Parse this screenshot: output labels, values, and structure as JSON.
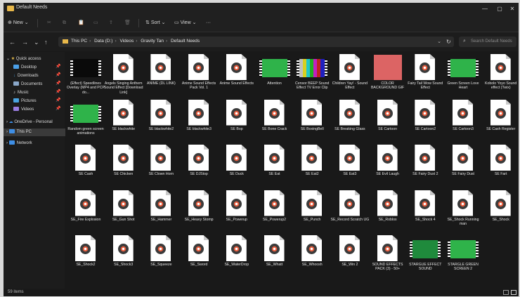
{
  "window": {
    "title": "Default Needs"
  },
  "controls": {
    "minimize": "—",
    "maximize": "▢",
    "close": "✕"
  },
  "toolbar": {
    "new": "New",
    "new_icon": "plus-icon",
    "cut": "✂",
    "copy": "⧉",
    "paste": "📋",
    "rename": "▭",
    "share": "⇪",
    "delete": "🗑",
    "sort": "Sort",
    "view": "View",
    "more": "···"
  },
  "nav_buttons": {
    "back": "←",
    "forward": "→",
    "down": "⌄",
    "up": "↑",
    "refresh": "↻",
    "chevron": "⌄"
  },
  "breadcrumbs": [
    "This PC",
    "Data (D:)",
    "Videos",
    "Gravity Tan",
    "Default Needs"
  ],
  "search": {
    "placeholder": "Search Default Needs"
  },
  "sidebar": {
    "quick_access": "Quick access",
    "items": [
      {
        "label": "Desktop",
        "color": "#4a9fe8"
      },
      {
        "label": "Downloads",
        "color": "#4aa3e0"
      },
      {
        "label": "Documents",
        "color": "#8aa7c8"
      },
      {
        "label": "Music",
        "color": "#e0e0e0"
      },
      {
        "label": "Pictures",
        "color": "#4aa3e0"
      },
      {
        "label": "Videos",
        "color": "#9a7de0"
      }
    ],
    "onedrive": "OneDrive - Personal",
    "this_pc": "This PC",
    "network": "Network"
  },
  "files": [
    {
      "name": "(Effect) Speedlines Overlay (MP4 and PCP do...",
      "thumb": "video",
      "frame": "#0a0a0a"
    },
    {
      "name": "Angels Singing Anthem Sound Effect [Download Link]",
      "thumb": "audio"
    },
    {
      "name": "ANIME (DL LINK)",
      "thumb": "audio"
    },
    {
      "name": "Anime Sound Effects Pack Vol. 1",
      "thumb": "audio"
    },
    {
      "name": "Anime Sound Effects",
      "thumb": "audio"
    },
    {
      "name": "Attention",
      "thumb": "video",
      "frame": "#2fb34a"
    },
    {
      "name": "Censor BEEP Sound Effect TV Error Clip",
      "thumb": "video",
      "frame": "bars"
    },
    {
      "name": "Children Yay! - Sound Effect",
      "thumb": "audio"
    },
    {
      "name": "COLOR BACKGROUND GIF",
      "thumb": "image",
      "frame": "#dc6464"
    },
    {
      "name": "Fairy Tail Wow Sound Effect",
      "thumb": "audio"
    },
    {
      "name": "Green Screen Love Heart",
      "thumb": "video",
      "frame": "#2fb34a"
    },
    {
      "name": "Kobolo Yoyo Sound effect (Twix)",
      "thumb": "audio"
    },
    {
      "name": "Random green screen animations",
      "thumb": "video",
      "frame": "#2fb34a"
    },
    {
      "name": "SE blackwhite",
      "thumb": "audio"
    },
    {
      "name": "SE blackwhite2",
      "thumb": "audio"
    },
    {
      "name": "SE blackwhite3",
      "thumb": "audio"
    },
    {
      "name": "SE Bop",
      "thumb": "audio"
    },
    {
      "name": "SE Bone Crack",
      "thumb": "audio"
    },
    {
      "name": "SE BoxingBell",
      "thumb": "audio"
    },
    {
      "name": "SE Breaking Glass",
      "thumb": "audio"
    },
    {
      "name": "SE Cartoon",
      "thumb": "audio"
    },
    {
      "name": "SE Cartoon2",
      "thumb": "audio"
    },
    {
      "name": "SE Cartoon3",
      "thumb": "audio"
    },
    {
      "name": "SE Cash Register",
      "thumb": "audio"
    },
    {
      "name": "SE Cash",
      "thumb": "audio"
    },
    {
      "name": "SE Chicken",
      "thumb": "audio"
    },
    {
      "name": "SE Clown Horn",
      "thumb": "audio"
    },
    {
      "name": "SE DJStop",
      "thumb": "audio"
    },
    {
      "name": "SE Duck",
      "thumb": "audio"
    },
    {
      "name": "SE Eat",
      "thumb": "audio"
    },
    {
      "name": "SE Eat2",
      "thumb": "audio"
    },
    {
      "name": "SE Eat3",
      "thumb": "audio"
    },
    {
      "name": "SE Evil Laugh",
      "thumb": "audio"
    },
    {
      "name": "SE Fairy Dust 2",
      "thumb": "audio"
    },
    {
      "name": "SE Fairy Dust",
      "thumb": "audio"
    },
    {
      "name": "SE Fart",
      "thumb": "audio"
    },
    {
      "name": "SE_Fire Explosion",
      "thumb": "audio"
    },
    {
      "name": "SE_Gun Shot",
      "thumb": "audio"
    },
    {
      "name": "SE_Hammer",
      "thumb": "audio"
    },
    {
      "name": "SE_Heavy Stomp",
      "thumb": "audio"
    },
    {
      "name": "SE_Powerup",
      "thumb": "audio"
    },
    {
      "name": "SE_Powerup2",
      "thumb": "audio"
    },
    {
      "name": "SE_Punch",
      "thumb": "audio"
    },
    {
      "name": "SE_Record Scratch UG",
      "thumb": "audio"
    },
    {
      "name": "SE_Roblox",
      "thumb": "audio"
    },
    {
      "name": "SE_Shock 4",
      "thumb": "audio"
    },
    {
      "name": "SE_Shock Running man",
      "thumb": "audio"
    },
    {
      "name": "SE_Shock",
      "thumb": "audio"
    },
    {
      "name": "SE_Shock2",
      "thumb": "audio"
    },
    {
      "name": "SE_Shock3",
      "thumb": "audio"
    },
    {
      "name": "SE_Squeeze",
      "thumb": "audio"
    },
    {
      "name": "SE_Sword",
      "thumb": "audio"
    },
    {
      "name": "SE_WaterDrop",
      "thumb": "audio"
    },
    {
      "name": "SE_Whatt",
      "thumb": "audio"
    },
    {
      "name": "SE_Whoosh",
      "thumb": "audio"
    },
    {
      "name": "SE_Win 2",
      "thumb": "audio"
    },
    {
      "name": "SOUND EFFECTS PACK (3) - 50+",
      "thumb": "audio"
    },
    {
      "name": "STARGUE EFFECT SOUND",
      "thumb": "video",
      "frame": "#1f8a3c"
    },
    {
      "name": "STARGLE GREEN SCREEN 2",
      "thumb": "video",
      "frame": "#2fb34a"
    }
  ],
  "status": {
    "count": "59 items"
  }
}
